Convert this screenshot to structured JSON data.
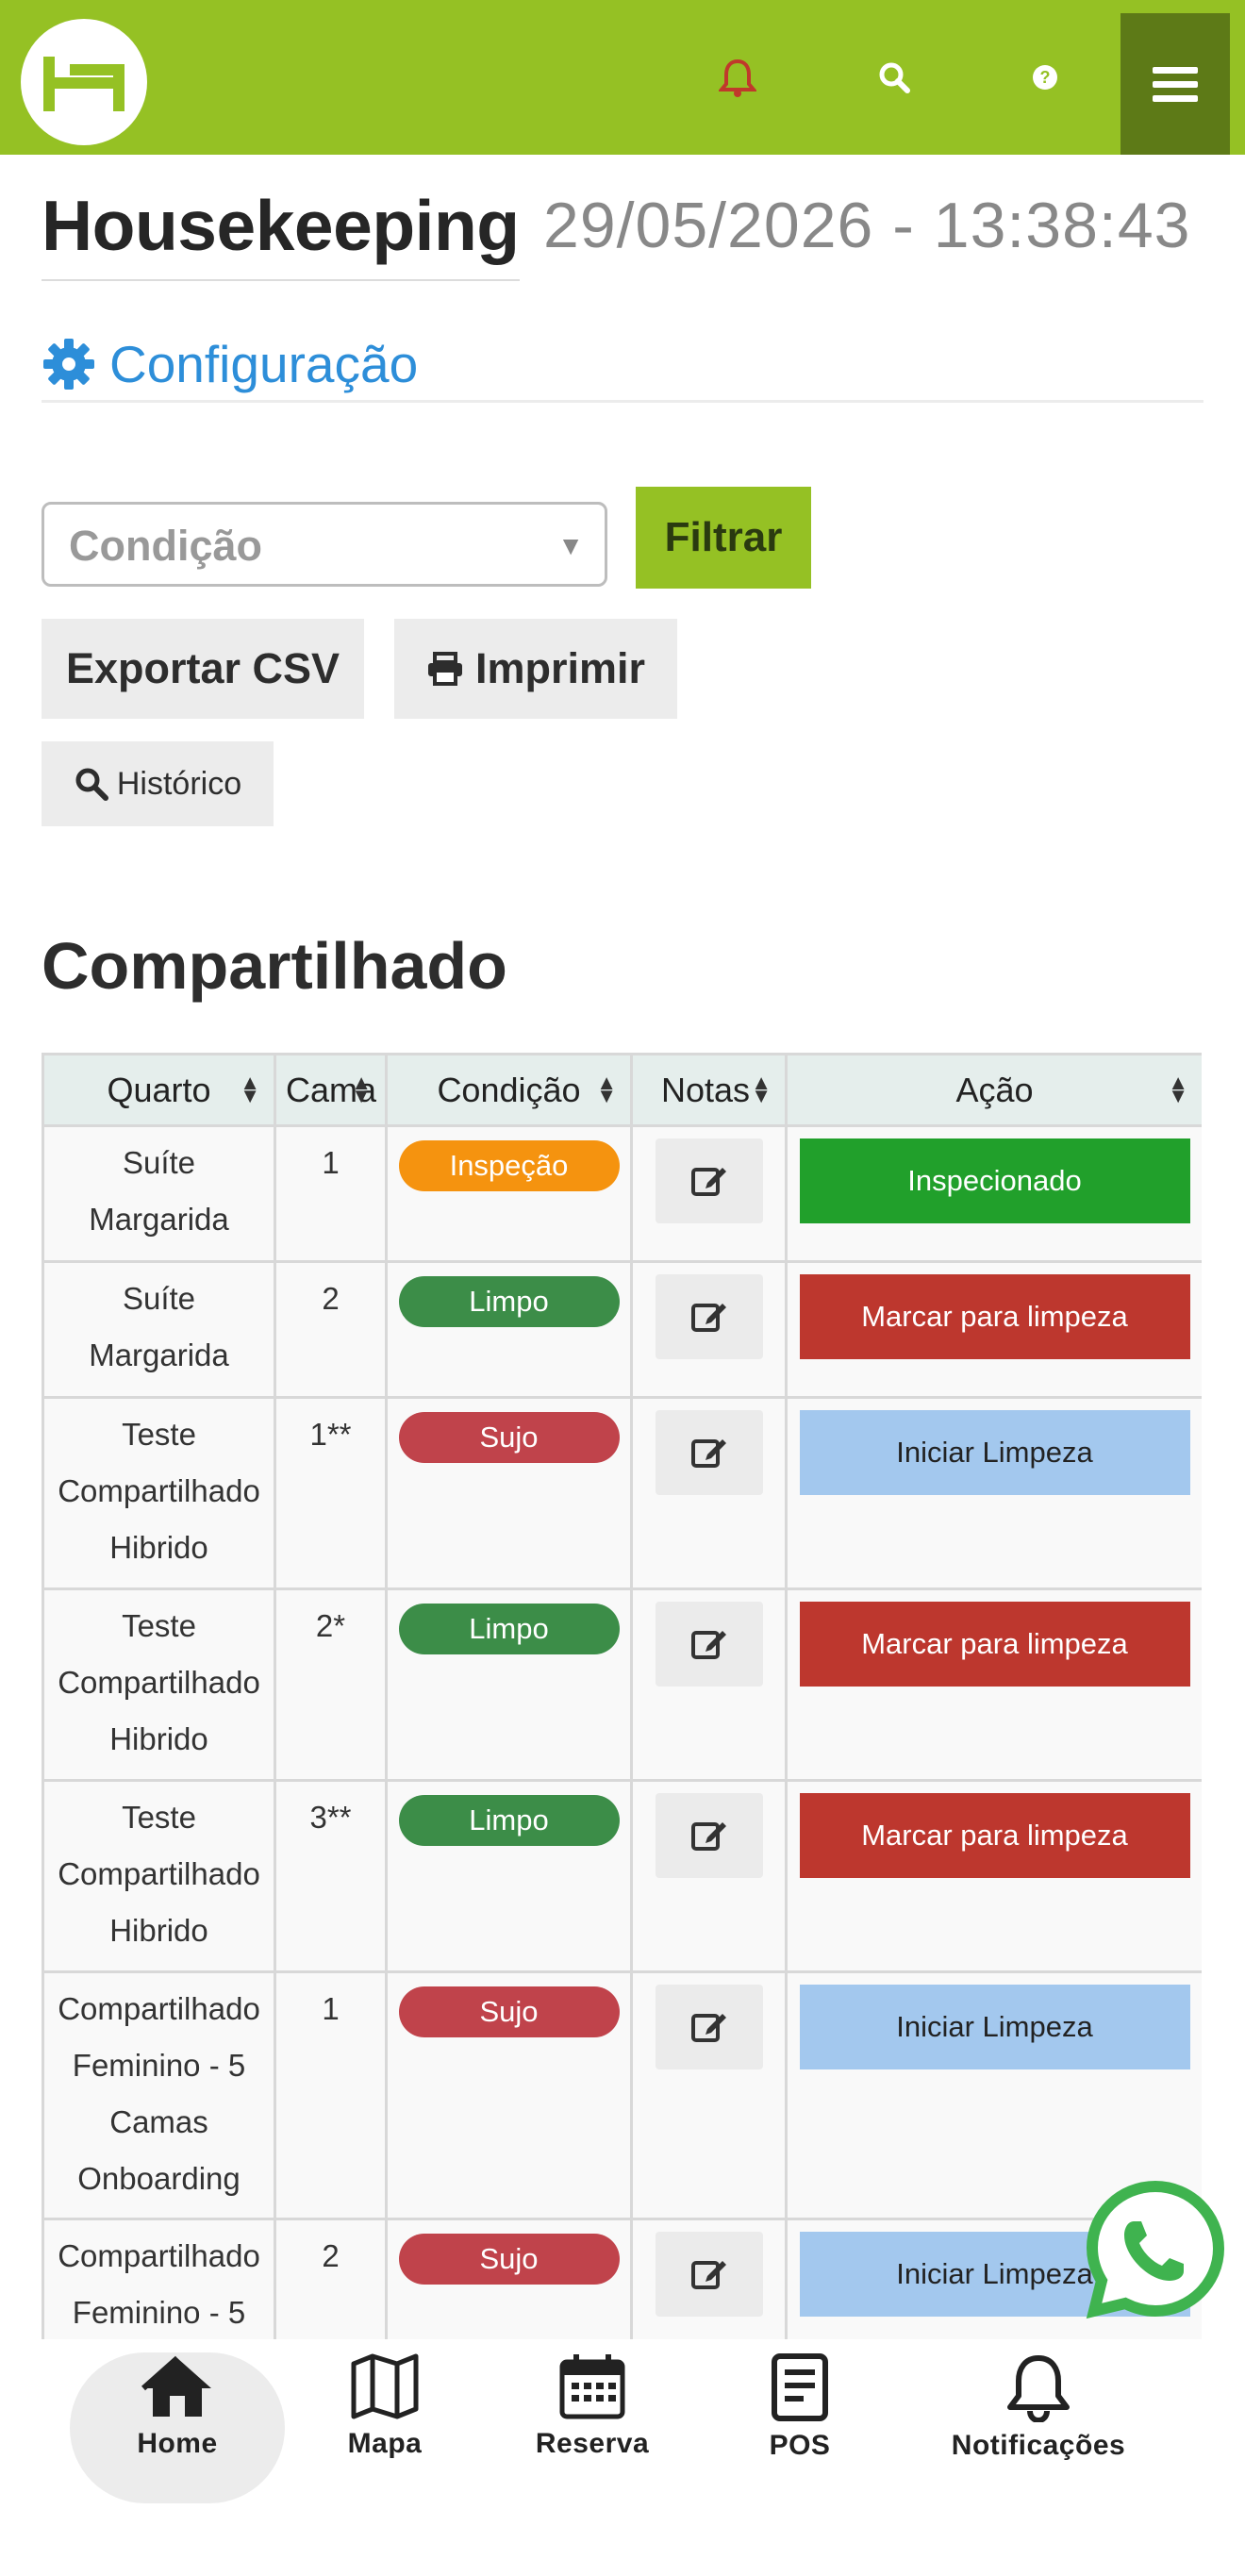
{
  "app": {
    "title": "Housekeeping",
    "datetime": "29/05/2026 - 13:38:43",
    "logo_icon": "hotel-bed-logo-icon"
  },
  "header": {
    "icons": [
      "bell-icon",
      "search-icon",
      "help-icon",
      "hamburger-menu-icon"
    ],
    "accent_color": "#95c124",
    "menu_color": "#5d7a17"
  },
  "config": {
    "label": "Configuração",
    "icon": "gear-icon"
  },
  "filters": {
    "condition_placeholder": "Condição",
    "filter_label": "Filtrar",
    "export_label": "Exportar CSV",
    "print_label": "Imprimir",
    "history_label": "Histórico"
  },
  "section": {
    "title": "Compartilhado"
  },
  "table": {
    "headers": [
      "Quarto",
      "Cama",
      "Condição",
      "Notas",
      "Ação"
    ],
    "rows": [
      {
        "room": "Suíte Margarida",
        "room_lines": [
          "Suíte",
          "Margarida"
        ],
        "bed": "1",
        "condition": "Inspeção",
        "condition_color": "orange",
        "action": "Inspecionado",
        "action_color": "green"
      },
      {
        "room": "Suíte Margarida",
        "room_lines": [
          "Suíte",
          "Margarida"
        ],
        "bed": "2",
        "condition": "Limpo",
        "condition_color": "green",
        "action": "Marcar para limpeza",
        "action_color": "red"
      },
      {
        "room": "Teste Compartilhado Hibrido",
        "room_lines": [
          "Teste",
          "Compartilhado",
          "Hibrido"
        ],
        "bed": "1**",
        "condition": "Sujo",
        "condition_color": "red",
        "action": "Iniciar Limpeza",
        "action_color": "blue"
      },
      {
        "room": "Teste Compartilhado Hibrido",
        "room_lines": [
          "Teste",
          "Compartilhado",
          "Hibrido"
        ],
        "bed": "2*",
        "condition": "Limpo",
        "condition_color": "green",
        "action": "Marcar para limpeza",
        "action_color": "red"
      },
      {
        "room": "Teste Compartilhado Hibrido",
        "room_lines": [
          "Teste",
          "Compartilhado",
          "Hibrido"
        ],
        "bed": "3**",
        "condition": "Limpo",
        "condition_color": "green",
        "action": "Marcar para limpeza",
        "action_color": "red"
      },
      {
        "room": "Compartilhado Feminino - 5 Camas Onboarding",
        "room_lines": [
          "Compartilhado",
          "Feminino - 5",
          "Camas",
          "Onboarding"
        ],
        "bed": "1",
        "condition": "Sujo",
        "condition_color": "red",
        "action": "Iniciar Limpeza",
        "action_color": "blue"
      },
      {
        "room": "Compartilhado Feminino - 5",
        "room_lines": [
          "Compartilhado",
          "Feminino - 5"
        ],
        "bed": "2",
        "condition": "Sujo",
        "condition_color": "red",
        "action": "Iniciar Limpeza",
        "action_color": "blue"
      }
    ]
  },
  "bottom_nav": [
    {
      "label": "Home",
      "icon": "home-icon",
      "active": true
    },
    {
      "label": "Mapa",
      "icon": "map-icon"
    },
    {
      "label": "Reserva",
      "icon": "calendar-icon"
    },
    {
      "label": "POS",
      "icon": "receipt-icon"
    },
    {
      "label": "Notificações",
      "icon": "bell-icon"
    }
  ]
}
